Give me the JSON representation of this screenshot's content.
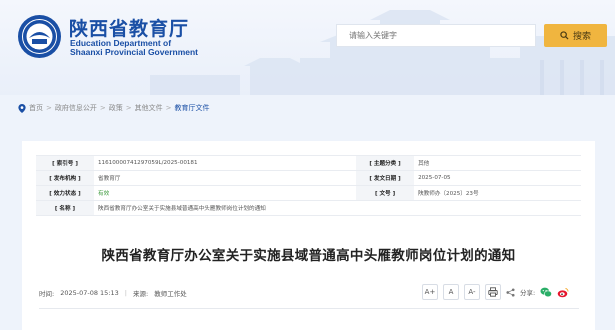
{
  "header": {
    "logo_cn": "陕西省教育厅",
    "logo_en_line1": "Education Department of",
    "logo_en_line2": "Shaanxi Provincial Government",
    "emblem_text": "EDU",
    "search_placeholder": "请输入关键字",
    "search_button": "搜索"
  },
  "breadcrumb": {
    "items": [
      "首页",
      "政府信息公开",
      "政策",
      "其他文件",
      "教育厅文件"
    ],
    "separator": ">"
  },
  "meta_table": {
    "rows": [
      [
        {
          "k": "[ 索引号 ]",
          "v": "11610000741297059L/2025-00181"
        },
        {
          "k": "[ 主题分类 ]",
          "v": "其他"
        }
      ],
      [
        {
          "k": "[ 发布机构 ]",
          "v": "省教育厅"
        },
        {
          "k": "[ 发文日期 ]",
          "v": "2025-07-05"
        }
      ],
      [
        {
          "k": "[ 效力状态 ]",
          "v": "有效"
        },
        {
          "k": "[ 文号 ]",
          "v": "陕教师办〔2025〕23号"
        }
      ]
    ],
    "name_label": "[ 名称 ]",
    "name_value": "陕西省教育厅办公室关于实施县域普通高中头雁教师岗位计划的通知"
  },
  "document": {
    "title": "陕西省教育厅办公室关于实施县域普通高中头雁教师岗位计划的通知",
    "time_label": "时间:",
    "time_value": "2025-07-08 15:13",
    "info_sep": "|",
    "source_label": "来源:",
    "source_value": "教师工作处"
  },
  "tools": {
    "font_large": "A+",
    "font_medium": "A",
    "font_small": "A-",
    "share_label": "分享:"
  },
  "colors": {
    "brand_blue": "#1a4fa5",
    "search_button": "#f0b53f",
    "valid_green": "#3d9a3d",
    "wechat_green": "#2aae67",
    "weibo_red": "#e6162d"
  }
}
